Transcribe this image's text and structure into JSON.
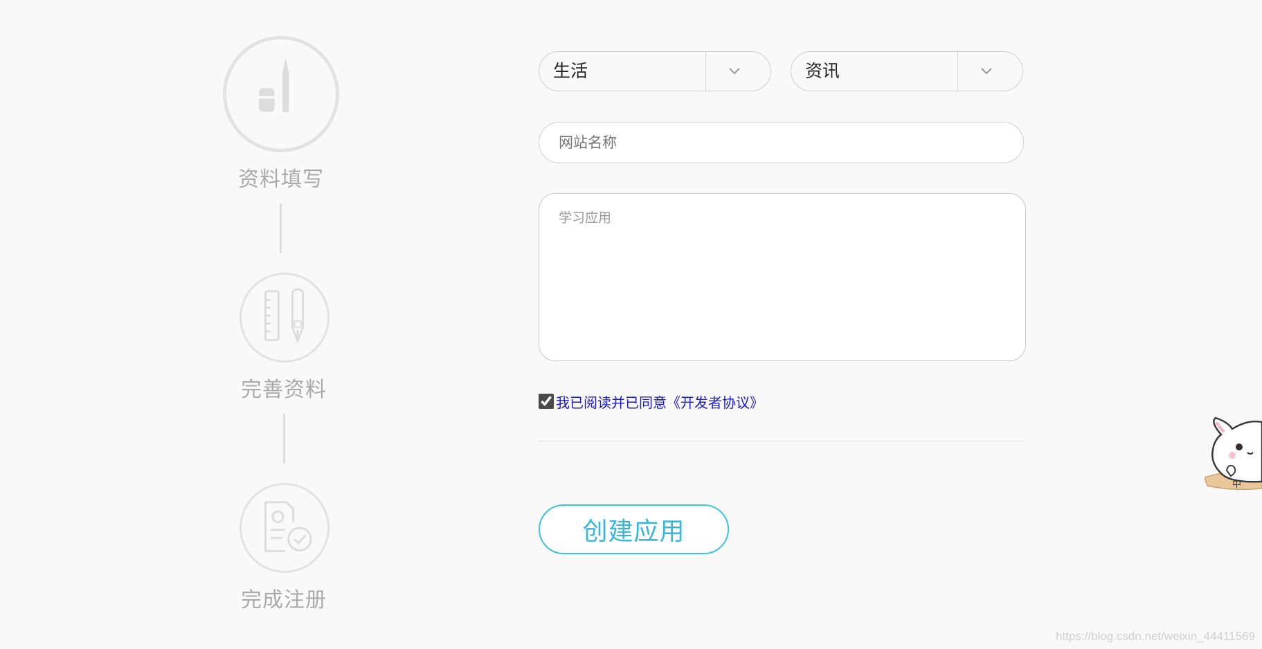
{
  "steps": [
    {
      "label": "资料填写",
      "icon": "pencil-eraser-icon"
    },
    {
      "label": "完善资料",
      "icon": "ruler-pen-icon"
    },
    {
      "label": "完成注册",
      "icon": "document-check-icon"
    }
  ],
  "form": {
    "category_select": {
      "value": "生活",
      "icon": "chevron-down-icon"
    },
    "type_select": {
      "value": "资讯",
      "icon": "chevron-down-icon"
    },
    "site_name": {
      "placeholder": "网站名称",
      "value": ""
    },
    "description": {
      "placeholder": "学习应用",
      "value": ""
    },
    "agreement": {
      "checked": true,
      "label": "我已阅读并已同意《开发者协议》"
    },
    "create_button": "创建应用"
  },
  "mascot": {
    "badge_text": "中"
  },
  "watermark": "https://blog.csdn.net/weixin_44411569",
  "colors": {
    "accent": "#38b6de",
    "link": "#1a1acc",
    "step_gray": "#aaaaaa",
    "background": "#f9f9f9"
  }
}
